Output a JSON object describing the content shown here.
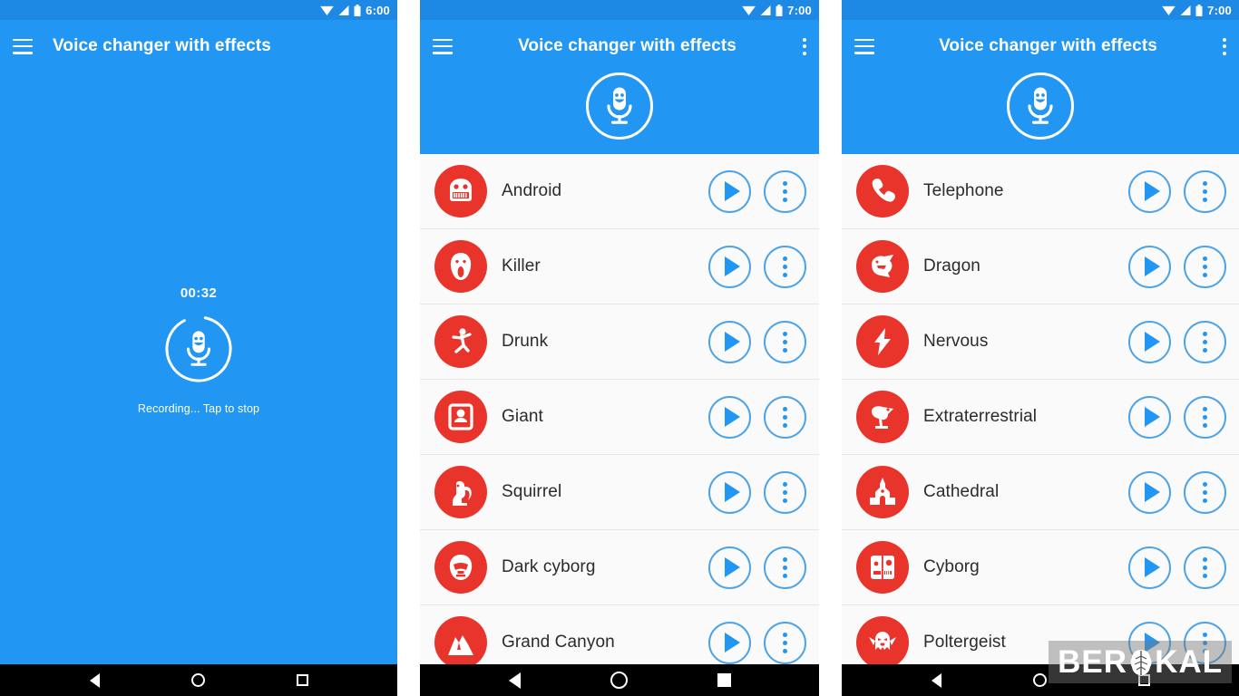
{
  "app": {
    "title": "Voice changer with effects",
    "accent_blue": "#2196F3",
    "status_blue": "#1E88E5",
    "icon_red": "#E8342A",
    "button_outline": "#4DA3E8",
    "list_bg": "#fafafa"
  },
  "panels": [
    {
      "id": "recording",
      "status": {
        "time": "6:00",
        "wifi": "wifi-icon",
        "signal": "signal-icon",
        "battery": "battery-icon"
      },
      "appbar": {
        "menu": "hamburger-icon",
        "title": "Voice changer with effects",
        "overflow": null
      },
      "record": {
        "timer": "00:32",
        "mic_icon": "microphone-smile-icon",
        "caption": "Recording... Tap to stop"
      },
      "nav": {
        "back": "back-triangle-icon",
        "home": "home-circle-icon",
        "recent": "recent-square-icon"
      }
    },
    {
      "id": "effects-list-a",
      "status": {
        "time": "7:00",
        "wifi": "wifi-icon",
        "signal": "signal-icon",
        "battery": "battery-icon"
      },
      "appbar": {
        "menu": "hamburger-icon",
        "title": "Voice changer with effects",
        "overflow": "overflow-menu-icon"
      },
      "header_mic": "microphone-smile-icon",
      "items": [
        {
          "label": "Android",
          "icon": "android-robot-icon",
          "play": "play-icon",
          "more": "overflow-menu-icon"
        },
        {
          "label": "Killer",
          "icon": "ghostface-mask-icon",
          "play": "play-icon",
          "more": "overflow-menu-icon"
        },
        {
          "label": "Drunk",
          "icon": "stumbling-man-icon",
          "play": "play-icon",
          "more": "overflow-menu-icon"
        },
        {
          "label": "Giant",
          "icon": "big-person-icon",
          "play": "play-icon",
          "more": "overflow-menu-icon"
        },
        {
          "label": "Squirrel",
          "icon": "squirrel-icon",
          "play": "play-icon",
          "more": "overflow-menu-icon"
        },
        {
          "label": "Dark cyborg",
          "icon": "darth-helmet-icon",
          "play": "play-icon",
          "more": "overflow-menu-icon"
        },
        {
          "label": "Grand Canyon",
          "icon": "canyon-icon",
          "play": "play-icon",
          "more": "overflow-menu-icon"
        }
      ],
      "nav": {
        "back": "back-triangle-icon",
        "home": "home-circle-icon",
        "recent": "recent-square-icon"
      }
    },
    {
      "id": "effects-list-b",
      "status": {
        "time": "7:00",
        "wifi": "wifi-icon",
        "signal": "signal-icon",
        "battery": "battery-icon"
      },
      "appbar": {
        "menu": "hamburger-icon",
        "title": "Voice changer with effects",
        "overflow": "overflow-menu-icon"
      },
      "header_mic": "microphone-smile-icon",
      "items": [
        {
          "label": "Telephone",
          "icon": "telephone-handset-icon",
          "play": "play-icon",
          "more": "overflow-menu-icon"
        },
        {
          "label": "Dragon",
          "icon": "dragon-head-icon",
          "play": "play-icon",
          "more": "overflow-menu-icon"
        },
        {
          "label": "Nervous",
          "icon": "lightning-bolt-icon",
          "play": "play-icon",
          "more": "overflow-menu-icon"
        },
        {
          "label": "Extraterrestrial",
          "icon": "alien-head-icon",
          "play": "play-icon",
          "more": "overflow-menu-icon"
        },
        {
          "label": "Cathedral",
          "icon": "church-icon",
          "play": "play-icon",
          "more": "overflow-menu-icon"
        },
        {
          "label": "Cyborg",
          "icon": "robot-face-icon",
          "play": "play-icon",
          "more": "overflow-menu-icon"
        },
        {
          "label": "Poltergeist",
          "icon": "ghost-icon",
          "play": "play-icon",
          "more": "overflow-menu-icon"
        }
      ],
      "nav": {
        "back": "back-triangle-icon",
        "home": "home-circle-icon",
        "recent": "recent-square-icon"
      }
    }
  ],
  "watermark": {
    "text_left": "BER",
    "text_right": "KAL",
    "logo": "brain-icon"
  }
}
